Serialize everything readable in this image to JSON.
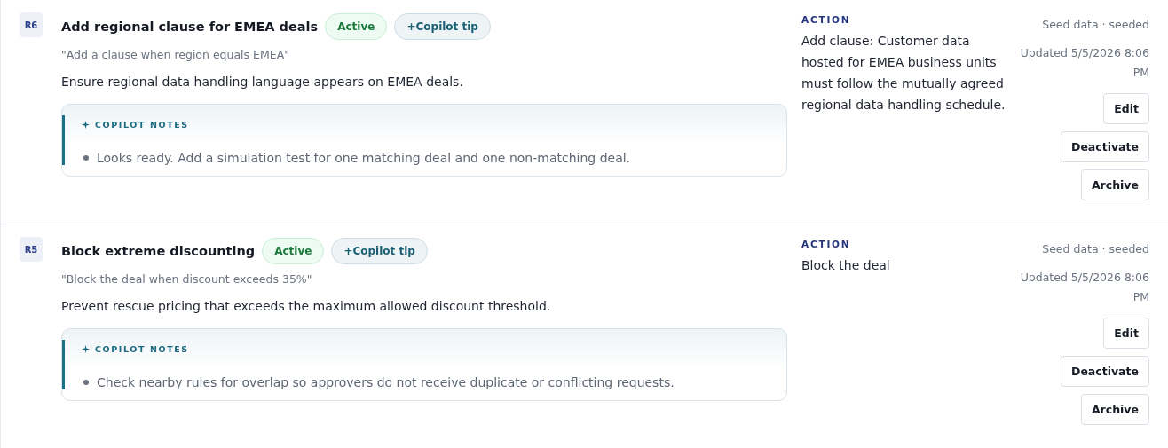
{
  "rules": [
    {
      "code": "R6",
      "title": "Add regional clause for EMEA deals",
      "status": {
        "label": "Active",
        "kind": "active"
      },
      "tip": "+Copilot tip",
      "quote": "\"Add a clause when region equals EMEA\"",
      "description": "Ensure regional data handling language appears on EMEA deals.",
      "notes": {
        "heading": "COPILOT NOTES",
        "items": [
          "Looks ready. Add a simulation test for one matching deal and one non-matching deal."
        ]
      },
      "action_label": "ACTION",
      "action": "Add clause: Customer data hosted for EMEA business units must follow the mutually agreed regional data handling schedule.",
      "source": "Seed data · seeded",
      "updated": "Updated 5/5/2026 8:06 PM",
      "buttons": [
        "Edit",
        "Deactivate",
        "Archive"
      ]
    },
    {
      "code": "R5",
      "title": "Block extreme discounting",
      "status": {
        "label": "Active",
        "kind": "active"
      },
      "tip": "+Copilot tip",
      "quote": "\"Block the deal when discount exceeds 35%\"",
      "description": "Prevent rescue pricing that exceeds the maximum allowed discount threshold.",
      "notes": {
        "heading": "COPILOT NOTES",
        "items": [
          "Check nearby rules for overlap so approvers do not receive duplicate or conflicting requests."
        ]
      },
      "action_label": "ACTION",
      "action": "Block the deal",
      "source": "Seed data · seeded",
      "updated": "Updated 5/5/2026 8:06 PM",
      "buttons": [
        "Edit",
        "Deactivate",
        "Archive"
      ]
    }
  ]
}
